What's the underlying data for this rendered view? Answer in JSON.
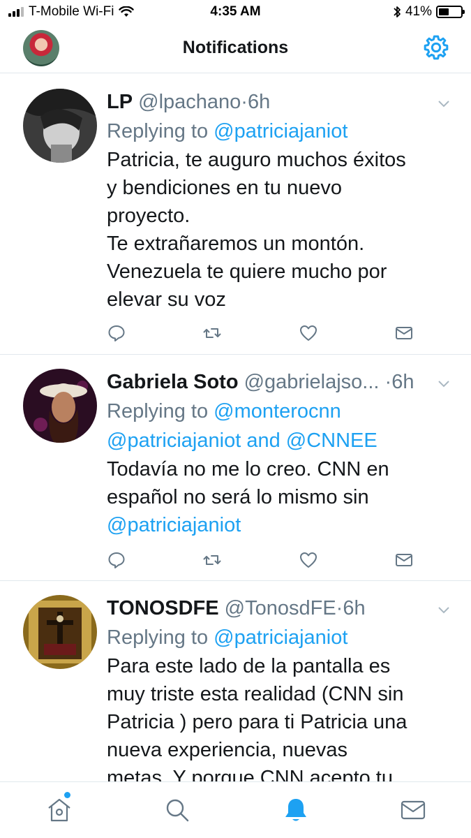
{
  "status_bar": {
    "carrier": "T-Mobile Wi-Fi",
    "time": "4:35 AM",
    "battery_percent": "41%",
    "battery_level": 0.41
  },
  "header": {
    "title": "Notifications"
  },
  "tweets": [
    {
      "name": "LP",
      "handle": "@lpachano",
      "dot": "·",
      "time": "6h",
      "reply_prefix": "Replying to",
      "reply_mentions_line1": "@patriciajaniot",
      "reply_mentions_line2": "",
      "text_lines": [
        "Patricia, te auguro muchos éxitos",
        "y bendiciones en tu nuevo",
        "proyecto.",
        "Te extrañaremos un montón.",
        "Venezuela te quiere mucho por",
        "elevar su voz"
      ],
      "text_mention": ""
    },
    {
      "name": "Gabriela Soto",
      "handle": "@gabrielajso...",
      "dot": "·",
      "time": "6h",
      "reply_prefix": "Replying to",
      "reply_mentions_line1": "@monterocnn",
      "reply_mentions_line2_a": "@patriciajaniot",
      "reply_and": "and",
      "reply_mentions_line2_b": "@CNNEE",
      "text_lines": [
        "Todavía no me lo creo. CNN en",
        "español no será lo mismo sin"
      ],
      "text_mention": "@patriciajaniot"
    },
    {
      "name": "TONOSDFE",
      "handle": "@TonosdFE",
      "dot": "·",
      "time": "6h",
      "reply_prefix": "Replying to",
      "reply_mentions_line1": "@patriciajaniot",
      "text_lines": [
        "Para este lado de la pantalla es",
        "muy triste esta realidad (CNN sin",
        "Patricia ) pero para ti Patricia una",
        "nueva experiencia, nuevas",
        "metas. Y porque CNN acepto tu"
      ],
      "text_mention": ""
    }
  ],
  "colors": {
    "accent": "#1da1f2",
    "secondary_text": "#657786",
    "divider": "#e1e8ed"
  },
  "icons": {
    "header_right": "gear-icon",
    "tweet_actions": [
      "reply-icon",
      "retweet-icon",
      "like-icon",
      "direct-message-icon"
    ],
    "tabs": [
      "home-icon",
      "search-icon",
      "notifications-bell-icon",
      "messages-icon"
    ]
  },
  "tab_bar": {
    "active": "notifications"
  }
}
